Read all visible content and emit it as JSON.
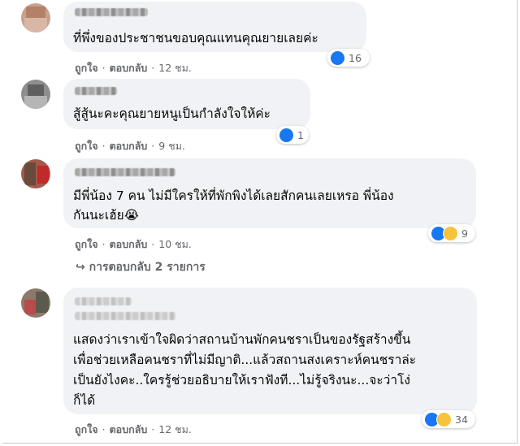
{
  "comments": [
    {
      "text_lines": [
        "ที่พึ่งของประชาชนขอบคุณแทนคุณยายเลยค่ะ"
      ],
      "like_label": "ถูกใจ",
      "reply_label": "ตอบกลับ",
      "time": "12 ชม.",
      "reaction_count": "16"
    },
    {
      "text_lines": [
        "สู้สู้นะคะคุณยายหนูเป็นกำลังใจให้ค่ะ"
      ],
      "like_label": "ถูกใจ",
      "reply_label": "ตอบกลับ",
      "time": "9 ชม.",
      "reaction_count": "1"
    },
    {
      "text_lines": [
        "มีพี่น้อง 7 คน ไม่มีใครให้ที่พักพิงได้เลยสักคนเลยเหรอ พี่น้อง",
        "กันนะเฮ้ย😭"
      ],
      "like_label": "ถูกใจ",
      "reply_label": "ตอบกลับ",
      "time": "10 ชม.",
      "reaction_count": "9"
    },
    {
      "text_lines": [
        "แสดงว่าเราเข้าใจผิดว่าสถานบ้านพักคนชราเป็นของรัฐสร้างขึ้น",
        "เพื่อช่วยเหลือคนชราที่ไม่มีญาติ...แล้วสถานสงเคราะห์คนชราล่ะ",
        "เป็นยังไงคะ..ใครรู้ช่วยอธิบายให้เราฟังที...ไม่รู้จริงนะ...จะว่าโง่",
        "ก็ได้"
      ],
      "like_label": "ถูกใจ",
      "reply_label": "ตอบกลับ",
      "time": "12 ชม.",
      "reaction_count": "34"
    }
  ],
  "replies_link": "↪ การตอบกลับ 2 รายการ",
  "colors": {
    "bubble": "#f0f2f5",
    "like": "#1877f2",
    "sad": "#f7c33d",
    "meta_text": "#65676b"
  },
  "icons": [
    "like-reaction-icon",
    "sad-reaction-icon",
    "reply-arrow-icon"
  ]
}
